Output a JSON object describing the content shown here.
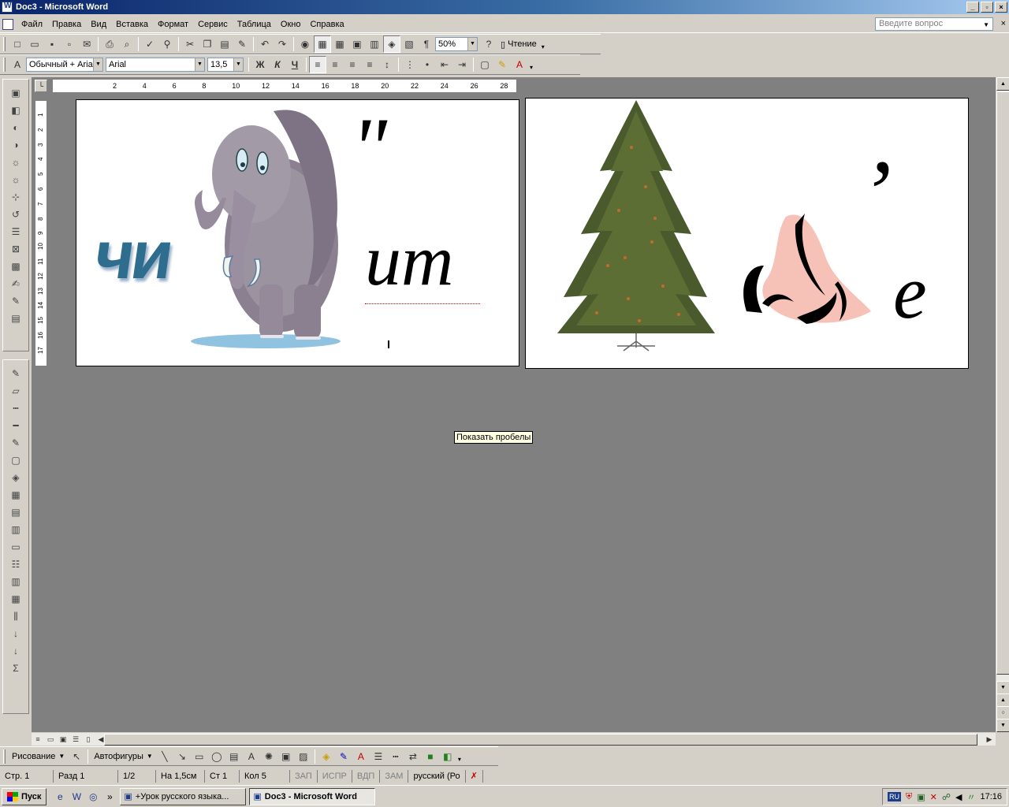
{
  "window": {
    "title": "Doc3 - Microsoft Word",
    "btn_min": "_",
    "btn_max": "▫",
    "btn_close": "×"
  },
  "menu": {
    "items": [
      "Файл",
      "Правка",
      "Вид",
      "Вставка",
      "Формат",
      "Сервис",
      "Таблица",
      "Окно",
      "Справка"
    ],
    "ask_placeholder": "Введите вопрос",
    "close": "×"
  },
  "toolbar1": {
    "zoom": "50%",
    "read_label": "Чтение"
  },
  "toolbar2": {
    "style": "Обычный + Aria",
    "font": "Arial",
    "size": "13,5",
    "bold": "Ж",
    "italic": "К",
    "underline": "Ч"
  },
  "ruler": {
    "h_ticks": [
      "2",
      "4",
      "6",
      "8",
      "10",
      "12",
      "14",
      "16",
      "18",
      "20",
      "22",
      "24",
      "26",
      "28"
    ],
    "v_ticks": [
      "1",
      "2",
      "3",
      "4",
      "5",
      "6",
      "7",
      "8",
      "9",
      "10",
      "11",
      "12",
      "13",
      "14",
      "15",
      "16",
      "17"
    ]
  },
  "document": {
    "page1": {
      "left_text": "чи",
      "mark": "\"",
      "right_text": "ит"
    },
    "page2": {
      "mark": "’",
      "right_text": "е"
    }
  },
  "tooltip": "Показать пробелы",
  "drawbar": {
    "draw_label": "Рисование",
    "autoshapes_label": "Автофигуры"
  },
  "status": {
    "page": "Стр. 1",
    "section": "Разд 1",
    "pages": "1/2",
    "position": "На 1,5см",
    "line": "Ст 1",
    "col": "Кол 5",
    "rec": "ЗАП",
    "trk": "ИСПР",
    "ext": "ВДП",
    "ovr": "ЗАМ",
    "lang": "русский (Ро"
  },
  "taskbar": {
    "start": "Пуск",
    "items": [
      "+Урок  русского языка...",
      "Doc3 - Microsoft Word"
    ],
    "tray_lang": "RU",
    "time": "17:16"
  },
  "icons": {
    "colors": {
      "titlebar": "#0a246a",
      "menubar": "#d4d0c8",
      "workspace": "#808080",
      "tooltip": "#ffffe1"
    }
  }
}
